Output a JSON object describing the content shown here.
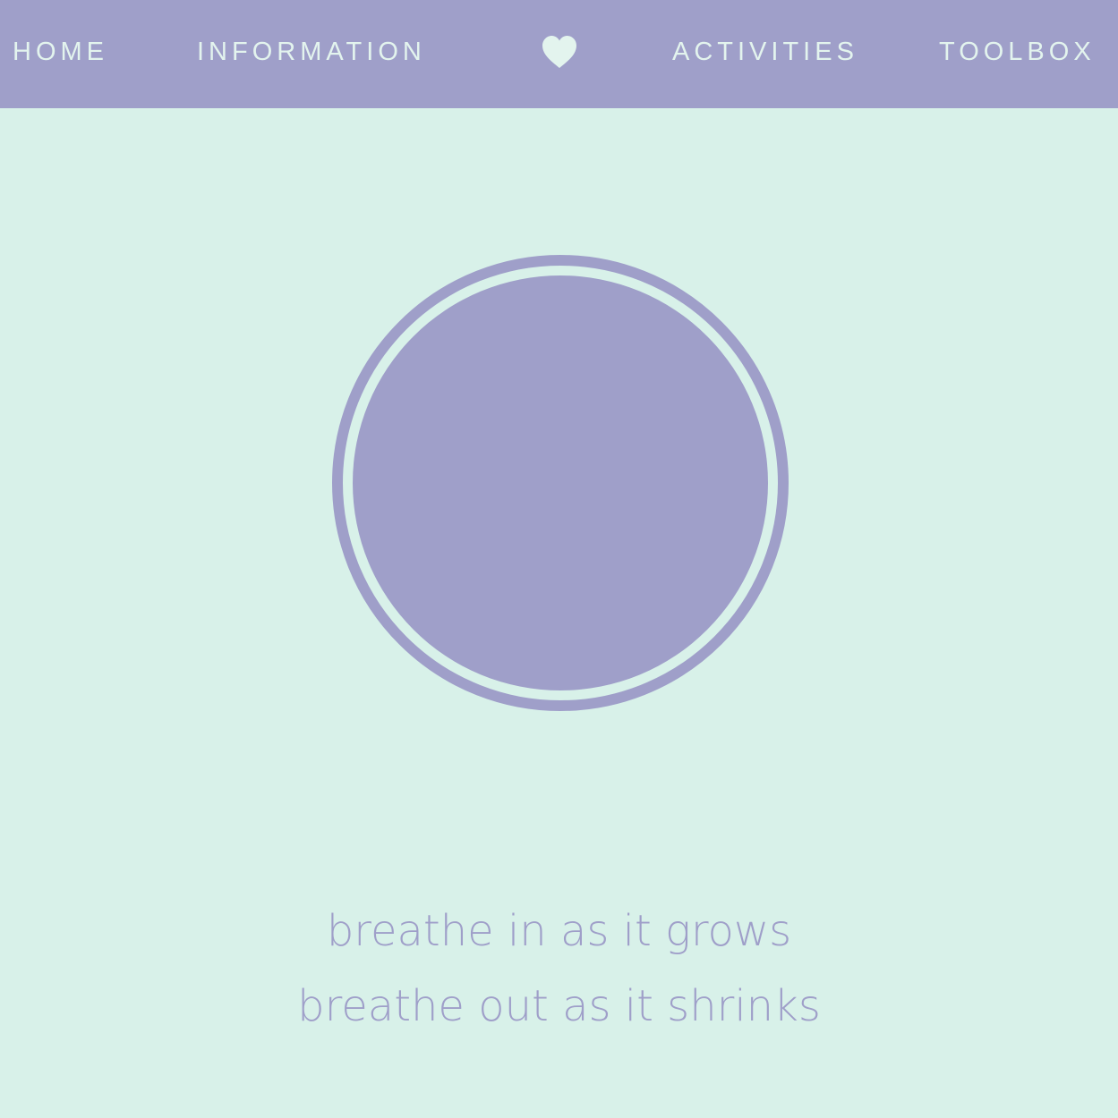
{
  "nav": {
    "home": "HOME",
    "information": "INFORMATION",
    "heart_icon": "heart-icon",
    "activities": "ACTIVITIES",
    "toolbox": "TOOLBOX"
  },
  "breathing": {
    "line_1": "breathe in as it grows",
    "line_2": "breathe out as it shrinks"
  },
  "colors": {
    "nav_background": "#9f9fc9",
    "nav_text": "#e3f4ee",
    "page_background": "#d8f1e9",
    "accent": "#9f9fc9"
  }
}
